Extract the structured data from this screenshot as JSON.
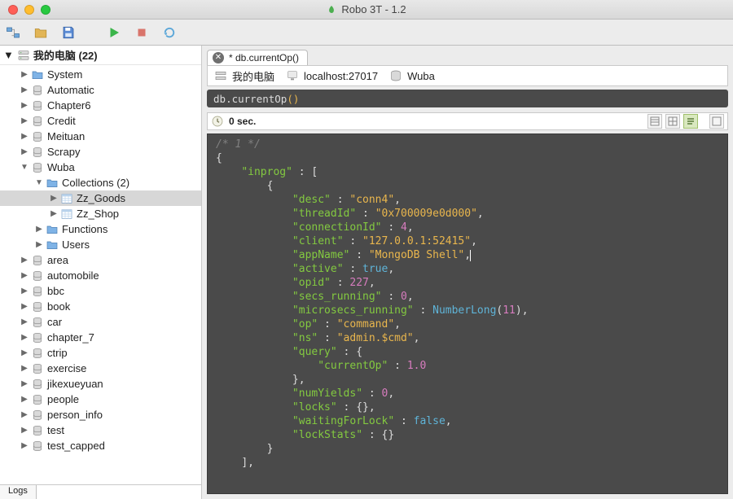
{
  "window": {
    "title": "Robo 3T - 1.2"
  },
  "toolbar": {
    "icons": [
      "connect-icon",
      "open-icon",
      "save-icon",
      "run-icon",
      "stop-icon",
      "rerun-icon"
    ]
  },
  "sidebar": {
    "root_label": "我的电脑 (22)",
    "items": [
      {
        "depth": 1,
        "arrow": "▶",
        "icon": "server",
        "label": "我的电脑 (22)"
      }
    ],
    "tree": [
      {
        "d": 1,
        "a": "▶",
        "i": "folder-blue",
        "l": "System"
      },
      {
        "d": 1,
        "a": "▶",
        "i": "db",
        "l": "Automatic"
      },
      {
        "d": 1,
        "a": "▶",
        "i": "db",
        "l": "Chapter6"
      },
      {
        "d": 1,
        "a": "▶",
        "i": "db",
        "l": "Credit"
      },
      {
        "d": 1,
        "a": "▶",
        "i": "db",
        "l": "Meituan"
      },
      {
        "d": 1,
        "a": "▶",
        "i": "db",
        "l": "Scrapy"
      },
      {
        "d": 1,
        "a": "▼",
        "i": "db",
        "l": "Wuba"
      },
      {
        "d": 2,
        "a": "▼",
        "i": "folder-blue",
        "l": "Collections (2)"
      },
      {
        "d": 3,
        "a": "▶",
        "i": "table",
        "l": "Zz_Goods",
        "sel": true
      },
      {
        "d": 3,
        "a": "▶",
        "i": "table",
        "l": "Zz_Shop"
      },
      {
        "d": 2,
        "a": "▶",
        "i": "folder-blue",
        "l": "Functions"
      },
      {
        "d": 2,
        "a": "▶",
        "i": "folder-blue",
        "l": "Users"
      },
      {
        "d": 1,
        "a": "▶",
        "i": "db",
        "l": "area"
      },
      {
        "d": 1,
        "a": "▶",
        "i": "db",
        "l": "automobile"
      },
      {
        "d": 1,
        "a": "▶",
        "i": "db",
        "l": "bbc"
      },
      {
        "d": 1,
        "a": "▶",
        "i": "db",
        "l": "book"
      },
      {
        "d": 1,
        "a": "▶",
        "i": "db",
        "l": "car"
      },
      {
        "d": 1,
        "a": "▶",
        "i": "db",
        "l": "chapter_7"
      },
      {
        "d": 1,
        "a": "▶",
        "i": "db",
        "l": "ctrip"
      },
      {
        "d": 1,
        "a": "▶",
        "i": "db",
        "l": "exercise"
      },
      {
        "d": 1,
        "a": "▶",
        "i": "db",
        "l": "jikexueyuan"
      },
      {
        "d": 1,
        "a": "▶",
        "i": "db",
        "l": "people"
      },
      {
        "d": 1,
        "a": "▶",
        "i": "db",
        "l": "person_info"
      },
      {
        "d": 1,
        "a": "▶",
        "i": "db",
        "l": "test"
      },
      {
        "d": 1,
        "a": "▶",
        "i": "db",
        "l": "test_capped"
      }
    ],
    "logs_label": "Logs"
  },
  "editor": {
    "tab_label": "* db.currentOp()",
    "crumbs": {
      "conn": "我的电脑",
      "host": "localhost:27017",
      "db": "Wuba"
    },
    "query_prefix": "db",
    "query_dot": ".",
    "query_fn": "currentOp",
    "query_p1": "(",
    "query_p2": ")",
    "timing": "0 sec.",
    "result_lines": [
      {
        "t": "comment",
        "txt": "/* 1 */"
      },
      {
        "t": "punc",
        "txt": "{"
      },
      {
        "t": "kv",
        "ind": 1,
        "k": "inprog",
        "post": ": ["
      },
      {
        "t": "punc",
        "ind": 2,
        "txt": "{"
      },
      {
        "t": "kv",
        "ind": 3,
        "k": "desc",
        "vs": "conn4",
        "comma": true
      },
      {
        "t": "kv",
        "ind": 3,
        "k": "threadId",
        "vs": "0x700009e0d000",
        "comma": true
      },
      {
        "t": "kv",
        "ind": 3,
        "k": "connectionId",
        "vn": "4",
        "comma": true
      },
      {
        "t": "kv",
        "ind": 3,
        "k": "client",
        "vs": "127.0.0.1:52415",
        "comma": true
      },
      {
        "t": "kv",
        "ind": 3,
        "k": "appName",
        "vs": "MongoDB Shell",
        "comma": true,
        "cursor": true
      },
      {
        "t": "kv",
        "ind": 3,
        "k": "active",
        "vb": "true",
        "comma": true
      },
      {
        "t": "kv",
        "ind": 3,
        "k": "opid",
        "vn": "227",
        "comma": true
      },
      {
        "t": "kv",
        "ind": 3,
        "k": "secs_running",
        "vn": "0",
        "comma": true
      },
      {
        "t": "kv",
        "ind": 3,
        "k": "microsecs_running",
        "vf": "NumberLong",
        "va": "11",
        "comma": true
      },
      {
        "t": "kv",
        "ind": 3,
        "k": "op",
        "vs": "command",
        "comma": true
      },
      {
        "t": "kv",
        "ind": 3,
        "k": "ns",
        "vs": "admin.$cmd",
        "comma": true
      },
      {
        "t": "kv",
        "ind": 3,
        "k": "query",
        "post": ": {"
      },
      {
        "t": "kv",
        "ind": 4,
        "k": "currentOp",
        "vn": "1.0"
      },
      {
        "t": "punc",
        "ind": 3,
        "txt": "},"
      },
      {
        "t": "kv",
        "ind": 3,
        "k": "numYields",
        "vn": "0",
        "comma": true
      },
      {
        "t": "kv",
        "ind": 3,
        "k": "locks",
        "post": ": {},"
      },
      {
        "t": "kv",
        "ind": 3,
        "k": "waitingForLock",
        "vb": "false",
        "comma": true
      },
      {
        "t": "kv",
        "ind": 3,
        "k": "lockStats",
        "post": ": {}"
      },
      {
        "t": "punc",
        "ind": 2,
        "txt": "}"
      },
      {
        "t": "punc",
        "ind": 1,
        "txt": "],"
      }
    ]
  }
}
